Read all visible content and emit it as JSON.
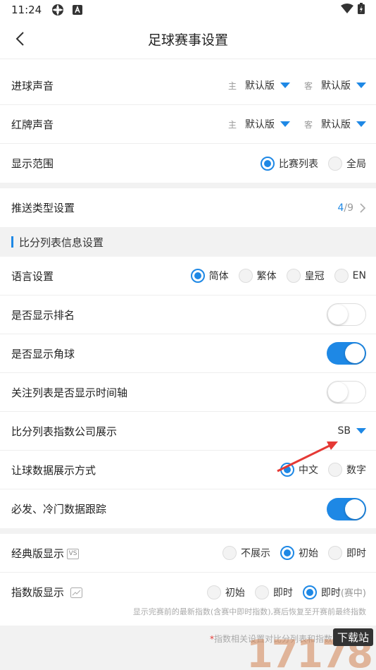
{
  "status": {
    "time": "11:24"
  },
  "header": {
    "title": "足球赛事设置"
  },
  "goal_sound": {
    "label": "进球声音",
    "home_tag": "主",
    "home_value": "默认版",
    "away_tag": "客",
    "away_value": "默认版"
  },
  "red_card_sound": {
    "label": "红牌声音",
    "home_tag": "主",
    "home_value": "默认版",
    "away_tag": "客",
    "away_value": "默认版"
  },
  "display_range": {
    "label": "显示范围",
    "options": [
      "比赛列表",
      "全局"
    ],
    "selected": 0
  },
  "push_type": {
    "label": "推送类型设置",
    "count": "4",
    "sep_total": "/9"
  },
  "score_section": {
    "title": "比分列表信息设置"
  },
  "language": {
    "label": "语言设置",
    "options": [
      "简体",
      "繁体",
      "皇冠",
      "EN"
    ],
    "selected": 0
  },
  "show_rank": {
    "label": "是否显示排名",
    "on": false
  },
  "show_corner": {
    "label": "是否显示角球",
    "on": true
  },
  "show_timeline": {
    "label": "关注列表是否显示时间轴",
    "on": false
  },
  "index_company": {
    "label": "比分列表指数公司展示",
    "value": "SB"
  },
  "handicap_display": {
    "label": "让球数据展示方式",
    "options": [
      "中文",
      "数字"
    ],
    "selected": 0
  },
  "must_track": {
    "label": "必发、冷门数据跟踪",
    "on": true
  },
  "classic_display": {
    "label": "经典版显示",
    "icon_text": "VS",
    "options": [
      "不展示",
      "初始",
      "即时"
    ],
    "selected": 1
  },
  "index_display": {
    "label": "指数版显示",
    "options": [
      "初始",
      "即时",
      "即时"
    ],
    "option_suffix": "(赛中)",
    "selected": 2
  },
  "index_note": "显示完赛前的最新指数(含赛中即时指数),赛后恢复至开赛前最终指数",
  "footer": {
    "star": "*",
    "text": "指数相关设置对比分列表和指数列表生效"
  },
  "watermark": {
    "number": "17178",
    "tag": "下载站"
  },
  "colors": {
    "accent": "#1e88e5",
    "arrow": "#e53935"
  }
}
